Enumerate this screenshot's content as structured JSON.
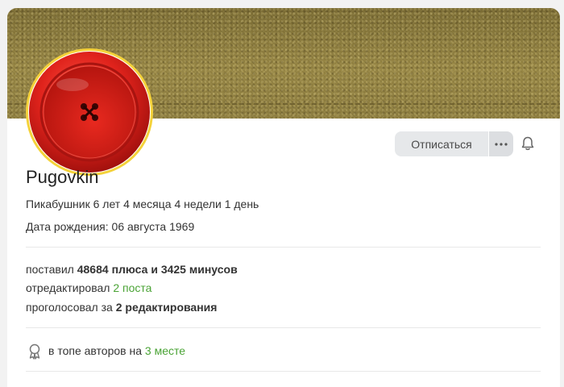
{
  "profile": {
    "username": "Pugovkin",
    "tenure": "Пикабушник 6 лет 4 месяца 4 недели 1 день",
    "birthday": "Дата рождения: 06 августа 1969"
  },
  "actions": {
    "unsubscribe_label": "Отписаться",
    "more_icon": "more-horizontal-icon",
    "bell_icon": "bell-icon"
  },
  "stats": {
    "votes_prefix": "поставил",
    "plus_count": "48684",
    "plus_label": "плюса и",
    "minus_count": "3425",
    "minus_label": "минусов",
    "edited_prefix": "отредактировал",
    "edited_value": "2 поста",
    "voted_prefix": "проголосовал за",
    "voted_count": "2",
    "voted_label": "редактирования"
  },
  "ranking": {
    "icon": "award-icon",
    "prefix": "в топе авторов на",
    "value": "3 месте"
  },
  "colors": {
    "accent_green": "#4aa335",
    "accent_red": "#d94a32",
    "avatar_ring": "#f4d23a"
  }
}
